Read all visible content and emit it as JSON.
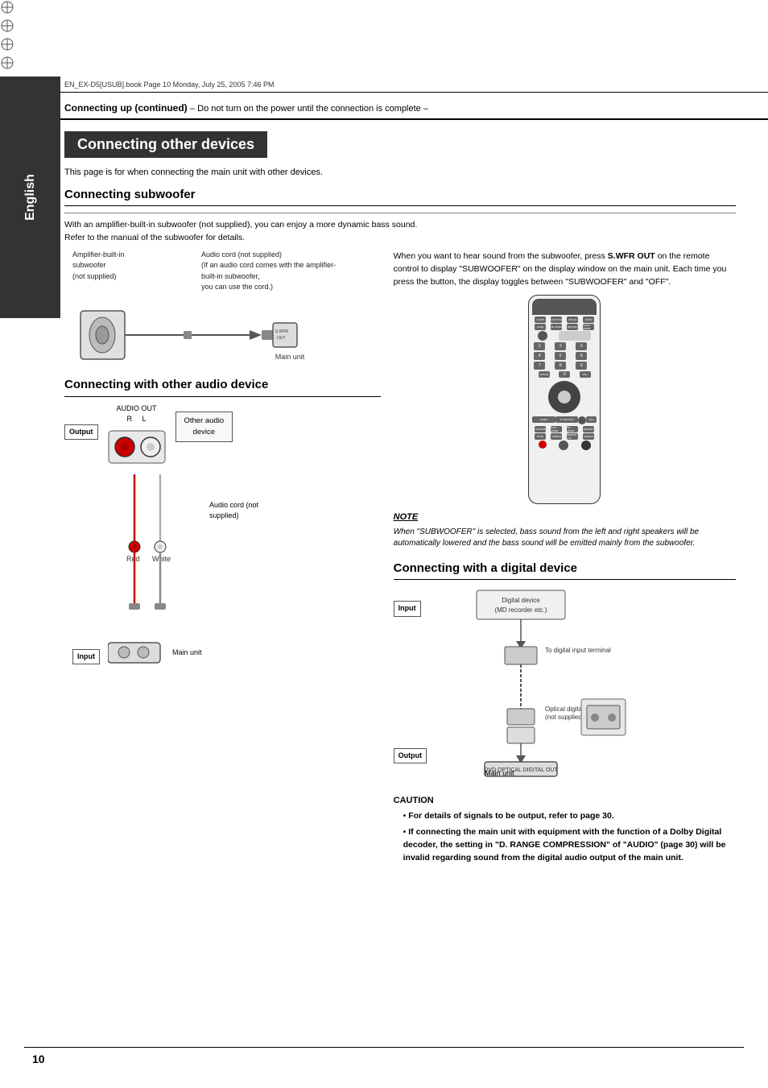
{
  "meta": {
    "file_info": "EN_EX-D5[USUB].book  Page 10  Monday, July 25, 2005  7:46 PM"
  },
  "header": {
    "title": "Connecting up (continued)",
    "subtitle": "– Do not turn on the power until the connection is complete –"
  },
  "sidebar": {
    "label": "English"
  },
  "page_title": {
    "text": "Connecting other devices"
  },
  "intro": {
    "text": "This page is for when connecting the main unit with other devices."
  },
  "subwoofer_section": {
    "title": "Connecting subwoofer",
    "description": "With an amplifier-built-in subwoofer (not supplied), you can enjoy a more dynamic bass sound.\nRefer to the manual of the subwoofer for details.",
    "label_amplifier": "Amplifier-built-in subwoofer\n(not supplied)",
    "label_audio_cord": "Audio cord (not supplied)\n(If an audio cord comes with the amplifier-built-in subwoofer,\nyou can use the cord.)",
    "label_main_unit": "Main unit",
    "right_text": "When you want to hear sound from the subwoofer, press S.WFR OUT on the remote control to display \"SUBWOOFER\" on the display window on the main unit. Each time you press the button, the display toggles between \"SUBWOOFER\" and \"OFF\".",
    "button_label": "S.WFR OUT",
    "note_title": "NOTE",
    "note_text": "When \"SUBWOOFER\" is selected, bass sound from the left and right speakers will be automatically lowered and the bass sound will be emitted mainly from the subwoofer."
  },
  "audio_section": {
    "title": "Connecting with other audio device",
    "label_output": "Output",
    "label_audio_out": "AUDIO OUT\nR    L",
    "label_other_device": "Other audio\ndevice",
    "label_audio_cord": "Audio cord (not\nsupplied)",
    "label_red": "Red",
    "label_white": "White",
    "label_input": "Input",
    "label_main_unit": "Main unit"
  },
  "digital_section": {
    "title": "Connecting with a digital device",
    "label_input": "Input",
    "label_digital_device": "Digital device\n(MD recorder etc.)",
    "label_to_digital": "To digital input terminal",
    "label_optical_cord": "Optical digital cord\n(not supplied)",
    "label_output": "Output",
    "label_main_unit": "Main unit"
  },
  "caution": {
    "title": "CAUTION",
    "items": [
      "For details of signals to be output, refer to page 30.",
      "If connecting the main unit with equipment with the function of a Dolby Digital decoder, the setting in \"D. RANGE COMPRESSION\" of \"AUDIO\" (page 30) will be invalid regarding sound from the digital audio output of the main unit."
    ]
  },
  "page_number": "10"
}
